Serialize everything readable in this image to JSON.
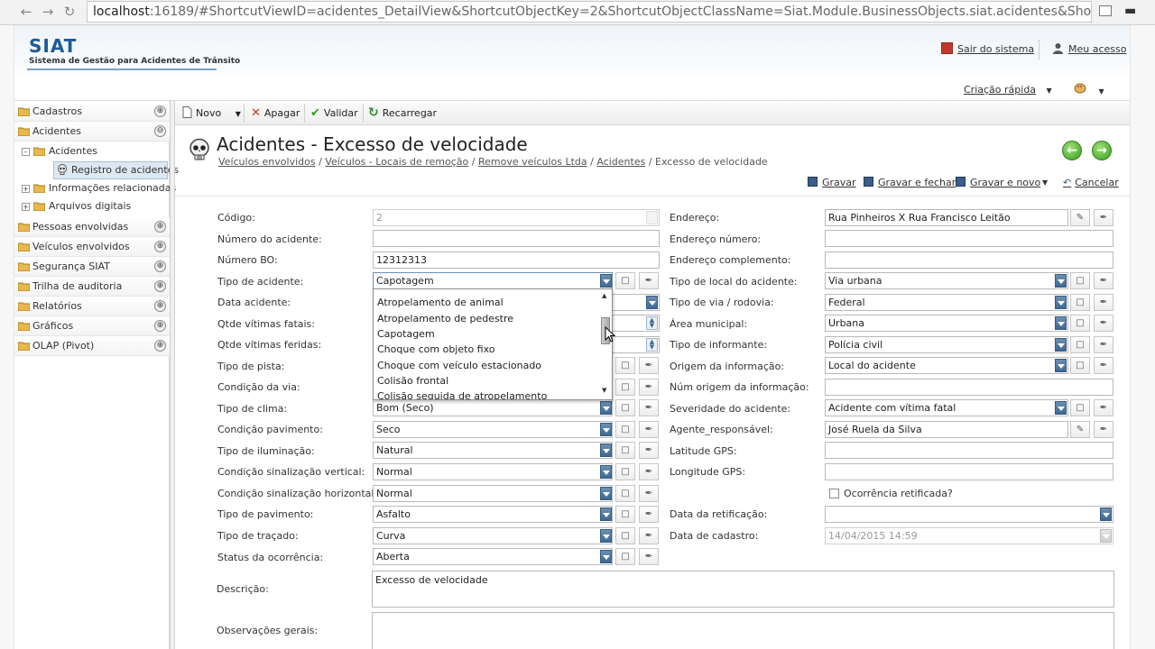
{
  "browser": {
    "url_host": "localhost",
    "url_rest": ":16189/#ShortcutViewID=acidentes_DetailView&ShortcutObjectKey=2&ShortcutObjectClassName=Siat.Module.BusinessObjects.siat.acidentes&Shortcutmode=Edit"
  },
  "header": {
    "app_name": "SIAT",
    "app_subtitle": "Sistema de Gestão para Acidentes de Trânsito",
    "logout_label": "Sair do sistema",
    "my_access_label": "Meu acesso",
    "quick_create_label": "Criação rápida"
  },
  "sidebar": {
    "items": [
      {
        "label": "Cadastros"
      },
      {
        "label": "Acidentes"
      },
      {
        "label": "Pessoas envolvidas"
      },
      {
        "label": "Veículos envolvidos"
      },
      {
        "label": "Segurança SIAT"
      },
      {
        "label": "Trilha de auditoria"
      },
      {
        "label": "Relatórios"
      },
      {
        "label": "Gráficos"
      },
      {
        "label": "OLAP (Pivot)"
      }
    ],
    "tree": {
      "accidents": "Acidentes",
      "accident_record": "Registro de acidentes",
      "related_info": "Informações relacionadas",
      "digital_files": "Arquivos digitais"
    }
  },
  "toolbar": {
    "new_label": "Novo",
    "delete_label": "Apagar",
    "validate_label": "Validar",
    "reload_label": "Recarregar"
  },
  "page": {
    "title": "Acidentes - Excesso de velocidade",
    "breadcrumb": [
      "Veículos envolvidos",
      "Veículos - Locais de remoção",
      "Remove veículos Ltda",
      "Acidentes"
    ],
    "breadcrumb_current": "Excesso de velocidade",
    "actions": {
      "save": "Gravar",
      "save_close": "Gravar e fechar",
      "save_new": "Gravar e novo",
      "cancel": "Cancelar"
    }
  },
  "form_left": {
    "codigo": {
      "label": "Código:",
      "value": "2"
    },
    "numero_acidente": {
      "label": "Número do acidente:",
      "value": ""
    },
    "numero_bo": {
      "label": "Número BO:",
      "value": "12312313"
    },
    "tipo_acidente": {
      "label": "Tipo de acidente:",
      "value": "Capotagem"
    },
    "data_acidente": {
      "label": "Data acidente:"
    },
    "qtde_fatais": {
      "label": "Qtde vítimas fatais:"
    },
    "qtde_feridas": {
      "label": "Qtde vítimas feridas:"
    },
    "tipo_pista": {
      "label": "Tipo de pista:"
    },
    "condicao_via": {
      "label": "Condição da via:"
    },
    "tipo_clima": {
      "label": "Tipo de clima:",
      "value": "Bom (Seco)"
    },
    "condicao_pavimento": {
      "label": "Condição pavimento:",
      "value": "Seco"
    },
    "tipo_iluminacao": {
      "label": "Tipo de iluminação:",
      "value": "Natural"
    },
    "sinalizacao_vertical": {
      "label": "Condição sinalização vertical:",
      "value": "Normal"
    },
    "sinalizacao_horizontal": {
      "label": "Condição sinalização horizontal:",
      "value": "Normal"
    },
    "tipo_pavimento": {
      "label": "Tipo de pavimento:",
      "value": "Asfalto"
    },
    "tipo_tracado": {
      "label": "Tipo de traçado:",
      "value": "Curva"
    },
    "status_ocorrencia": {
      "label": "Status da ocorrência:",
      "value": "Aberta"
    },
    "descricao": {
      "label": "Descrição:",
      "value": "Excesso de velocidade"
    },
    "observacoes": {
      "label": "Observações gerais:",
      "value": ""
    }
  },
  "form_right": {
    "endereco": {
      "label": "Endereço:",
      "value": "Rua Pinheiros X Rua Francisco Leitão"
    },
    "endereco_numero": {
      "label": "Endereço número:",
      "value": ""
    },
    "endereco_complemento": {
      "label": "Endereço complemento:",
      "value": ""
    },
    "tipo_local": {
      "label": "Tipo de local do acidente:",
      "value": "Via urbana"
    },
    "tipo_via": {
      "label": "Tipo de via / rodovia:",
      "value": "Federal"
    },
    "area_municipal": {
      "label": "Área municipal:",
      "value": "Urbana"
    },
    "tipo_informante": {
      "label": "Tipo de informante:",
      "value": "Polícia civil"
    },
    "origem_informacao": {
      "label": "Origem da informação:",
      "value": "Local do acidente"
    },
    "num_origem": {
      "label": "Núm origem da informação:",
      "value": ""
    },
    "severidade": {
      "label": "Severidade do acidente:",
      "value": "Acidente com vítima fatal"
    },
    "agente": {
      "label": "Agente_responsável:",
      "value": "José Ruela da Silva"
    },
    "latitude": {
      "label": "Latitude GPS:",
      "value": ""
    },
    "longitude": {
      "label": "Longitude GPS:",
      "value": ""
    },
    "ocorrencia_retificada": {
      "label": "Ocorrência retificada?"
    },
    "data_retificacao": {
      "label": "Data da retificação:",
      "value": ""
    },
    "data_cadastro": {
      "label": "Data de cadastro:",
      "value": "14/04/2015 14:59"
    }
  },
  "dropdown": {
    "options": [
      "Atropelamento de animal",
      "Atropelamento de pedestre",
      "Capotagem",
      "Choque com objeto fixo",
      "Choque com veículo estacionado",
      "Colisão frontal",
      "Colisão seguida de atropelamento"
    ]
  },
  "colors": {
    "accent": "#1d5a96",
    "dropdown_button": "#4a7199",
    "go_button": "#3a9a1c"
  }
}
